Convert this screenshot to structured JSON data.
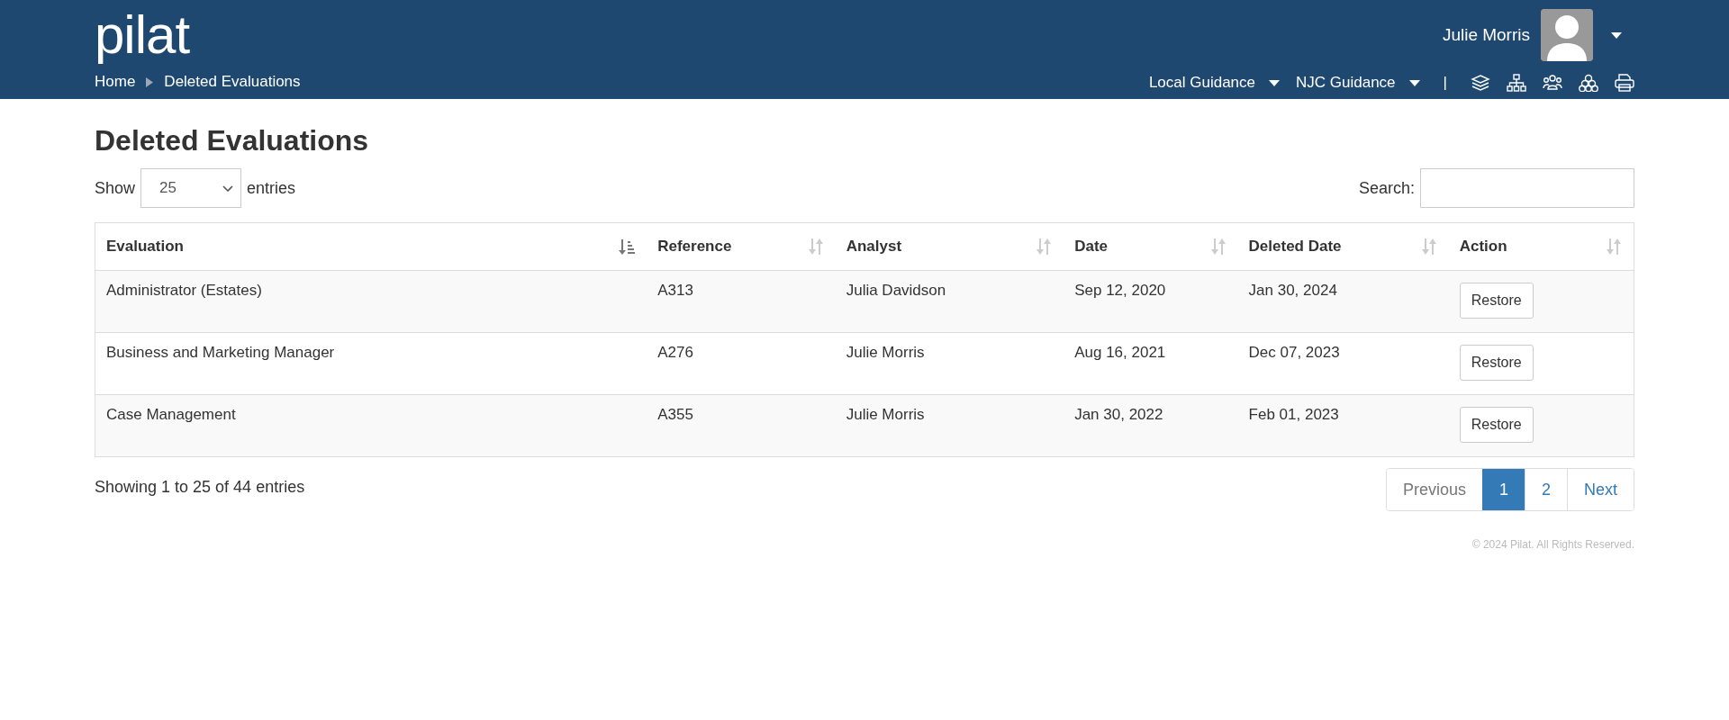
{
  "header": {
    "logo": "pilat",
    "user_name": "Julie Morris",
    "breadcrumb": [
      {
        "label": "Home"
      },
      {
        "label": "Deleted Evaluations"
      }
    ],
    "nav_menus": [
      {
        "label": "Local Guidance"
      },
      {
        "label": "NJC Guidance"
      }
    ],
    "separator": "|",
    "toolbar_icons": [
      {
        "kind": "layers"
      },
      {
        "kind": "sitemap"
      },
      {
        "kind": "users"
      },
      {
        "kind": "cluster"
      },
      {
        "kind": "print"
      }
    ]
  },
  "page_title": "Deleted Evaluations",
  "length_control": {
    "before": "Show",
    "value": "25",
    "after": "entries"
  },
  "search": {
    "label": "Search:"
  },
  "table": {
    "columns": [
      {
        "label": "Evaluation",
        "sorted": true
      },
      {
        "label": "Reference",
        "sorted": false
      },
      {
        "label": "Analyst",
        "sorted": false
      },
      {
        "label": "Date",
        "sorted": false
      },
      {
        "label": "Deleted Date",
        "sorted": false
      },
      {
        "label": "Action",
        "sorted": false
      }
    ],
    "rows": [
      {
        "cells": [
          "Administrator (Estates)",
          "A313",
          "Julia Davidson",
          "Sep 12, 2020",
          "Jan 30, 2024"
        ],
        "action": "Restore"
      },
      {
        "cells": [
          "Business and Marketing Manager",
          "A276",
          "Julie Morris",
          "Aug 16, 2021",
          "Dec 07, 2023"
        ],
        "action": "Restore"
      },
      {
        "cells": [
          "Case Management",
          "A355",
          "Julie Morris",
          "Jan 30, 2022",
          "Feb 01, 2023"
        ],
        "action": "Restore"
      }
    ]
  },
  "info": "Showing 1 to 25 of 44 entries",
  "pagination": [
    {
      "label": "Previous",
      "selected": false,
      "disabled": true
    },
    {
      "label": "1",
      "selected": true,
      "disabled": false
    },
    {
      "label": "2",
      "selected": false,
      "disabled": false
    },
    {
      "label": "Next",
      "selected": false,
      "disabled": false
    }
  ],
  "footer": "© 2024 Pilat. All Rights Reserved."
}
